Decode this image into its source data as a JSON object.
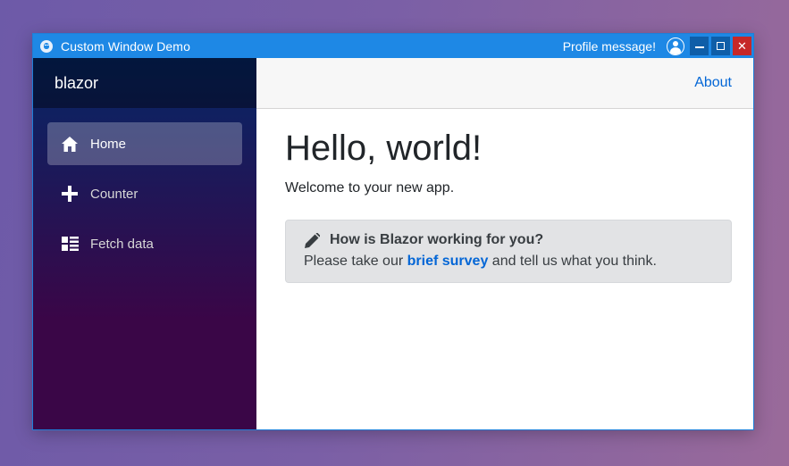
{
  "window": {
    "title": "Custom Window Demo",
    "profile_message": "Profile message!",
    "controls": {
      "minimize_icon": "minimize-icon",
      "maximize_icon": "maximize-icon",
      "close_icon": "close-icon",
      "close_glyph": "✕"
    }
  },
  "sidebar": {
    "brand": "blazor",
    "items": [
      {
        "label": "Home",
        "icon": "home-icon",
        "active": true
      },
      {
        "label": "Counter",
        "icon": "plus-icon",
        "active": false
      },
      {
        "label": "Fetch data",
        "icon": "list-rich-icon",
        "active": false
      }
    ]
  },
  "topbar": {
    "about": "About"
  },
  "main": {
    "title": "Hello, world!",
    "welcome": "Welcome to your new app.",
    "survey": {
      "heading": "How is Blazor working for you?",
      "text_before": "Please take our ",
      "link": "brief survey",
      "text_after": " and tell us what you think."
    }
  },
  "colors": {
    "titlebar": "#1e88e5",
    "link": "#0366d6",
    "close_button": "#c62828",
    "sidebar_top": "#052767",
    "sidebar_bottom": "#3a0647"
  }
}
